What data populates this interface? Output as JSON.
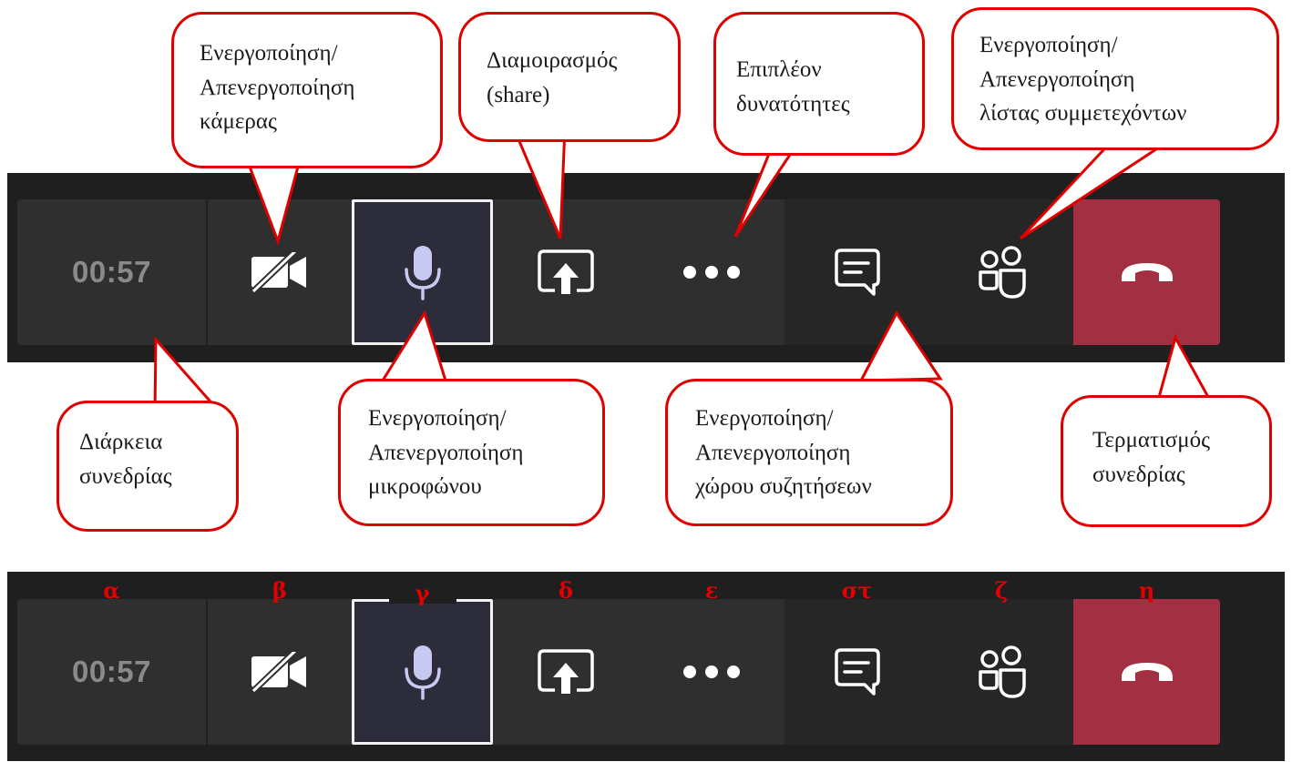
{
  "toolbar": {
    "timer": "00:57",
    "icons": {
      "camera": "camera-off-icon",
      "mic": "microphone-icon",
      "share": "share-screen-icon",
      "more": "more-options-icon",
      "chat": "chat-icon",
      "people": "participants-icon",
      "hangup": "hang-up-icon"
    }
  },
  "colors": {
    "toolbar_bg": "#1f1f1f",
    "button_bg": "#2f2f2f",
    "active_mic_bg": "#2c2c3a",
    "hangup_bg": "#a33042",
    "callout_border": "#e00000",
    "letter_color": "#e30000"
  },
  "callouts": {
    "camera": [
      "Ενεργοποίηση/",
      "Απενεργοποίηση",
      "κάμερας"
    ],
    "share": [
      "Διαμοιρασμός",
      "(share)"
    ],
    "more": [
      "Επιπλέον",
      "δυνατότητες"
    ],
    "participants": [
      "Ενεργοποίηση/",
      "Απενεργοποίηση",
      "λίστας συμμετεχόντων"
    ],
    "duration": [
      "Διάρκεια",
      "συνεδρίας"
    ],
    "microphone": [
      "Ενεργοποίηση/",
      "Απενεργοποίηση",
      "μικροφώνου"
    ],
    "chat": [
      "Ενεργοποίηση/",
      "Απενεργοποίηση",
      "χώρου συζητήσεων"
    ],
    "end": [
      "Τερματισμός",
      "συνεδρίας"
    ]
  },
  "letters": {
    "timer": "α",
    "camera": "β",
    "mic": "γ",
    "share": "δ",
    "more": "ε",
    "chat": "στ",
    "people": "ζ",
    "hangup": "η"
  }
}
